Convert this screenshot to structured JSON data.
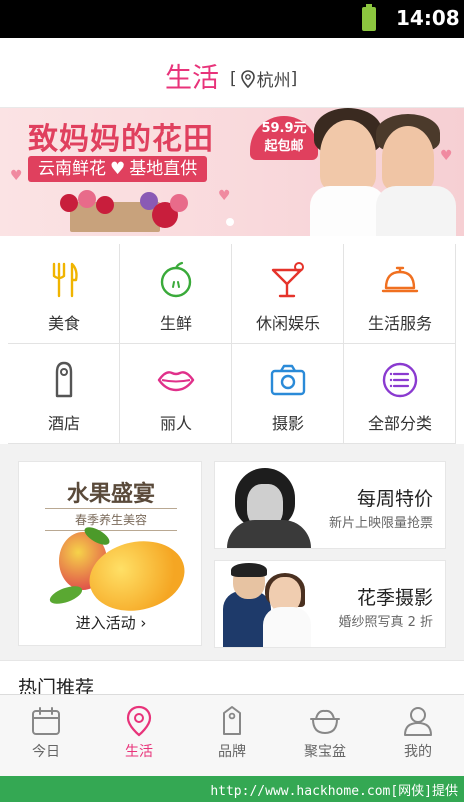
{
  "status_bar": {
    "time": "14:08"
  },
  "header": {
    "title": "生活",
    "city_prefix": "[",
    "city": "杭州",
    "city_suffix": "]"
  },
  "banner": {
    "headline": "致妈妈的花田",
    "subline_left": "云南鲜花",
    "subline_right": "基地直供",
    "price": "59.9元",
    "price_note": "起包邮"
  },
  "categories": [
    {
      "label": "美食",
      "icon": "utensils-icon",
      "color": "#f0b400"
    },
    {
      "label": "生鲜",
      "icon": "apple-icon",
      "color": "#3aaa3a"
    },
    {
      "label": "休闲娱乐",
      "icon": "cocktail-icon",
      "color": "#e5332a"
    },
    {
      "label": "生活服务",
      "icon": "service-bell-icon",
      "color": "#f07020"
    },
    {
      "label": "酒店",
      "icon": "door-hanger-icon",
      "color": "#555555"
    },
    {
      "label": "丽人",
      "icon": "lips-icon",
      "color": "#e0308a"
    },
    {
      "label": "摄影",
      "icon": "camera-icon",
      "color": "#2a8ad8"
    },
    {
      "label": "全部分类",
      "icon": "list-icon",
      "color": "#8a3ad0"
    }
  ],
  "promos": {
    "left": {
      "title": "水果盛宴",
      "subtitle": "春季养生美容",
      "action": "进入活动 ›"
    },
    "right_top": {
      "title": "每周特价",
      "subtitle": "新片上映限量抢票"
    },
    "right_bottom": {
      "title": "花季摄影",
      "subtitle": "婚纱照写真 2 折"
    }
  },
  "hot": {
    "title": "热门推荐"
  },
  "nav": {
    "items": [
      {
        "label": "今日",
        "icon": "calendar-icon",
        "active": false
      },
      {
        "label": "生活",
        "icon": "location-pin-icon",
        "active": true
      },
      {
        "label": "品牌",
        "icon": "tag-icon",
        "active": false
      },
      {
        "label": "聚宝盆",
        "icon": "treasure-bowl-icon",
        "active": false
      },
      {
        "label": "我的",
        "icon": "person-icon",
        "active": false
      }
    ]
  },
  "watermark": {
    "text": "http://www.hackhome.com[网侠]提供"
  },
  "colors": {
    "accent": "#e8337a",
    "banner_red": "#e0405e",
    "watermark_green": "#34a853"
  }
}
